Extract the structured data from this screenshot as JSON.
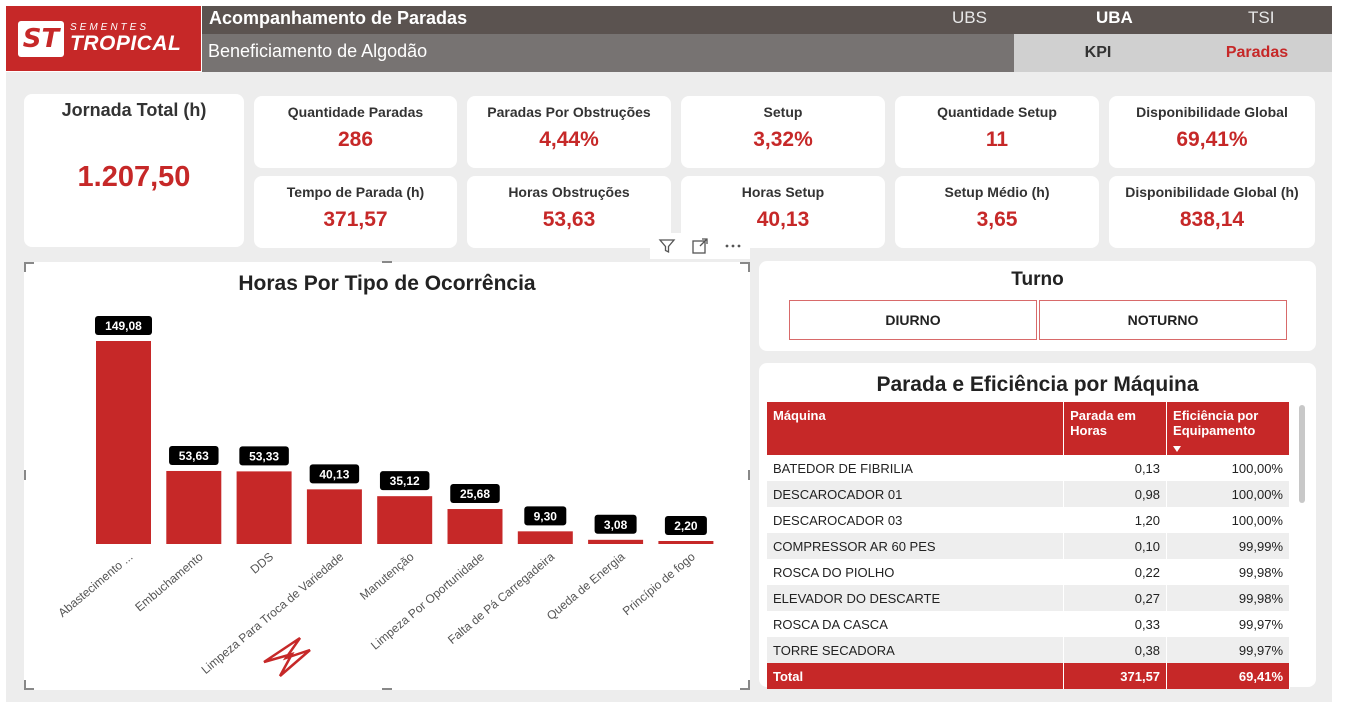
{
  "brand": {
    "mark": "ST",
    "line1": "SEMENTES",
    "line2": "TROPICAL"
  },
  "header": {
    "title": "Acompanhamento de Paradas",
    "subtitle": "Beneficiamento de Algodão",
    "units": [
      "UBS",
      "UBA",
      "TSI"
    ],
    "active_unit": "UBA",
    "nav": {
      "kpi": "KPI",
      "paradas": "Paradas"
    }
  },
  "kpis": {
    "jornada": {
      "label": "Jornada Total (h)",
      "value": "1.207,50"
    },
    "cards": [
      {
        "label": "Quantidade Paradas",
        "value": "286"
      },
      {
        "label": "Paradas Por Obstruções",
        "value": "4,44%"
      },
      {
        "label": "Setup",
        "value": "3,32%"
      },
      {
        "label": "Quantidade Setup",
        "value": "11"
      },
      {
        "label": "Disponibilidade Global",
        "value": "69,41%"
      },
      {
        "label": "Tempo de Parada (h)",
        "value": "371,57"
      },
      {
        "label": "Horas Obstruções",
        "value": "53,63"
      },
      {
        "label": "Horas Setup",
        "value": "40,13"
      },
      {
        "label": "Setup Médio (h)",
        "value": "3,65"
      },
      {
        "label": "Disponibilidade Global (h)",
        "value": "838,14"
      }
    ]
  },
  "toolbar": {
    "filter_icon": "filter-icon",
    "focus_icon": "focus-mode-icon",
    "more_icon": "more-options-icon"
  },
  "chart_data": {
    "type": "bar",
    "title": "Horas Por Tipo de Ocorrência",
    "categories": [
      "Abastecimento ...",
      "Embuchamento",
      "DDS",
      "Limpeza Para Troca de Variedade",
      "Manutenção",
      "Limpeza Por Oportunidade",
      "Falta de Pá Carregadeira",
      "Queda de Energia",
      "Princípio de fogo"
    ],
    "values": [
      149.08,
      53.63,
      53.33,
      40.13,
      35.12,
      25.68,
      9.3,
      3.08,
      2.2
    ],
    "labels": [
      "149,08",
      "53,63",
      "53,33",
      "40,13",
      "35,12",
      "25,68",
      "9,30",
      "3,08",
      "2,20"
    ],
    "color": "#c62828",
    "ylim": [
      0,
      149.08
    ],
    "grid": false
  },
  "turno": {
    "title": "Turno",
    "options": [
      "DIURNO",
      "NOTURNO"
    ]
  },
  "machine_table": {
    "title": "Parada e Eficiência por Máquina",
    "columns": [
      "Máquina",
      "Parada em Horas",
      "Eficiência por Equipamento"
    ],
    "rows": [
      [
        "BATEDOR DE FIBRILIA",
        "0,13",
        "100,00%"
      ],
      [
        "DESCAROCADOR 01",
        "0,98",
        "100,00%"
      ],
      [
        "DESCAROCADOR 03",
        "1,20",
        "100,00%"
      ],
      [
        "COMPRESSOR AR 60 PES",
        "0,10",
        "99,99%"
      ],
      [
        "ROSCA DO PIOLHO",
        "0,22",
        "99,98%"
      ],
      [
        "ELEVADOR DO DESCARTE",
        "0,27",
        "99,98%"
      ],
      [
        "ROSCA DA CASCA",
        "0,33",
        "99,97%"
      ],
      [
        "TORRE SECADORA",
        "0,38",
        "99,97%"
      ]
    ],
    "total": [
      "Total",
      "371,57",
      "69,41%"
    ]
  },
  "colors": {
    "accent": "#c62828",
    "header_dark": "#5b5350",
    "header_mid": "#777372",
    "canvas": "#ededed"
  }
}
